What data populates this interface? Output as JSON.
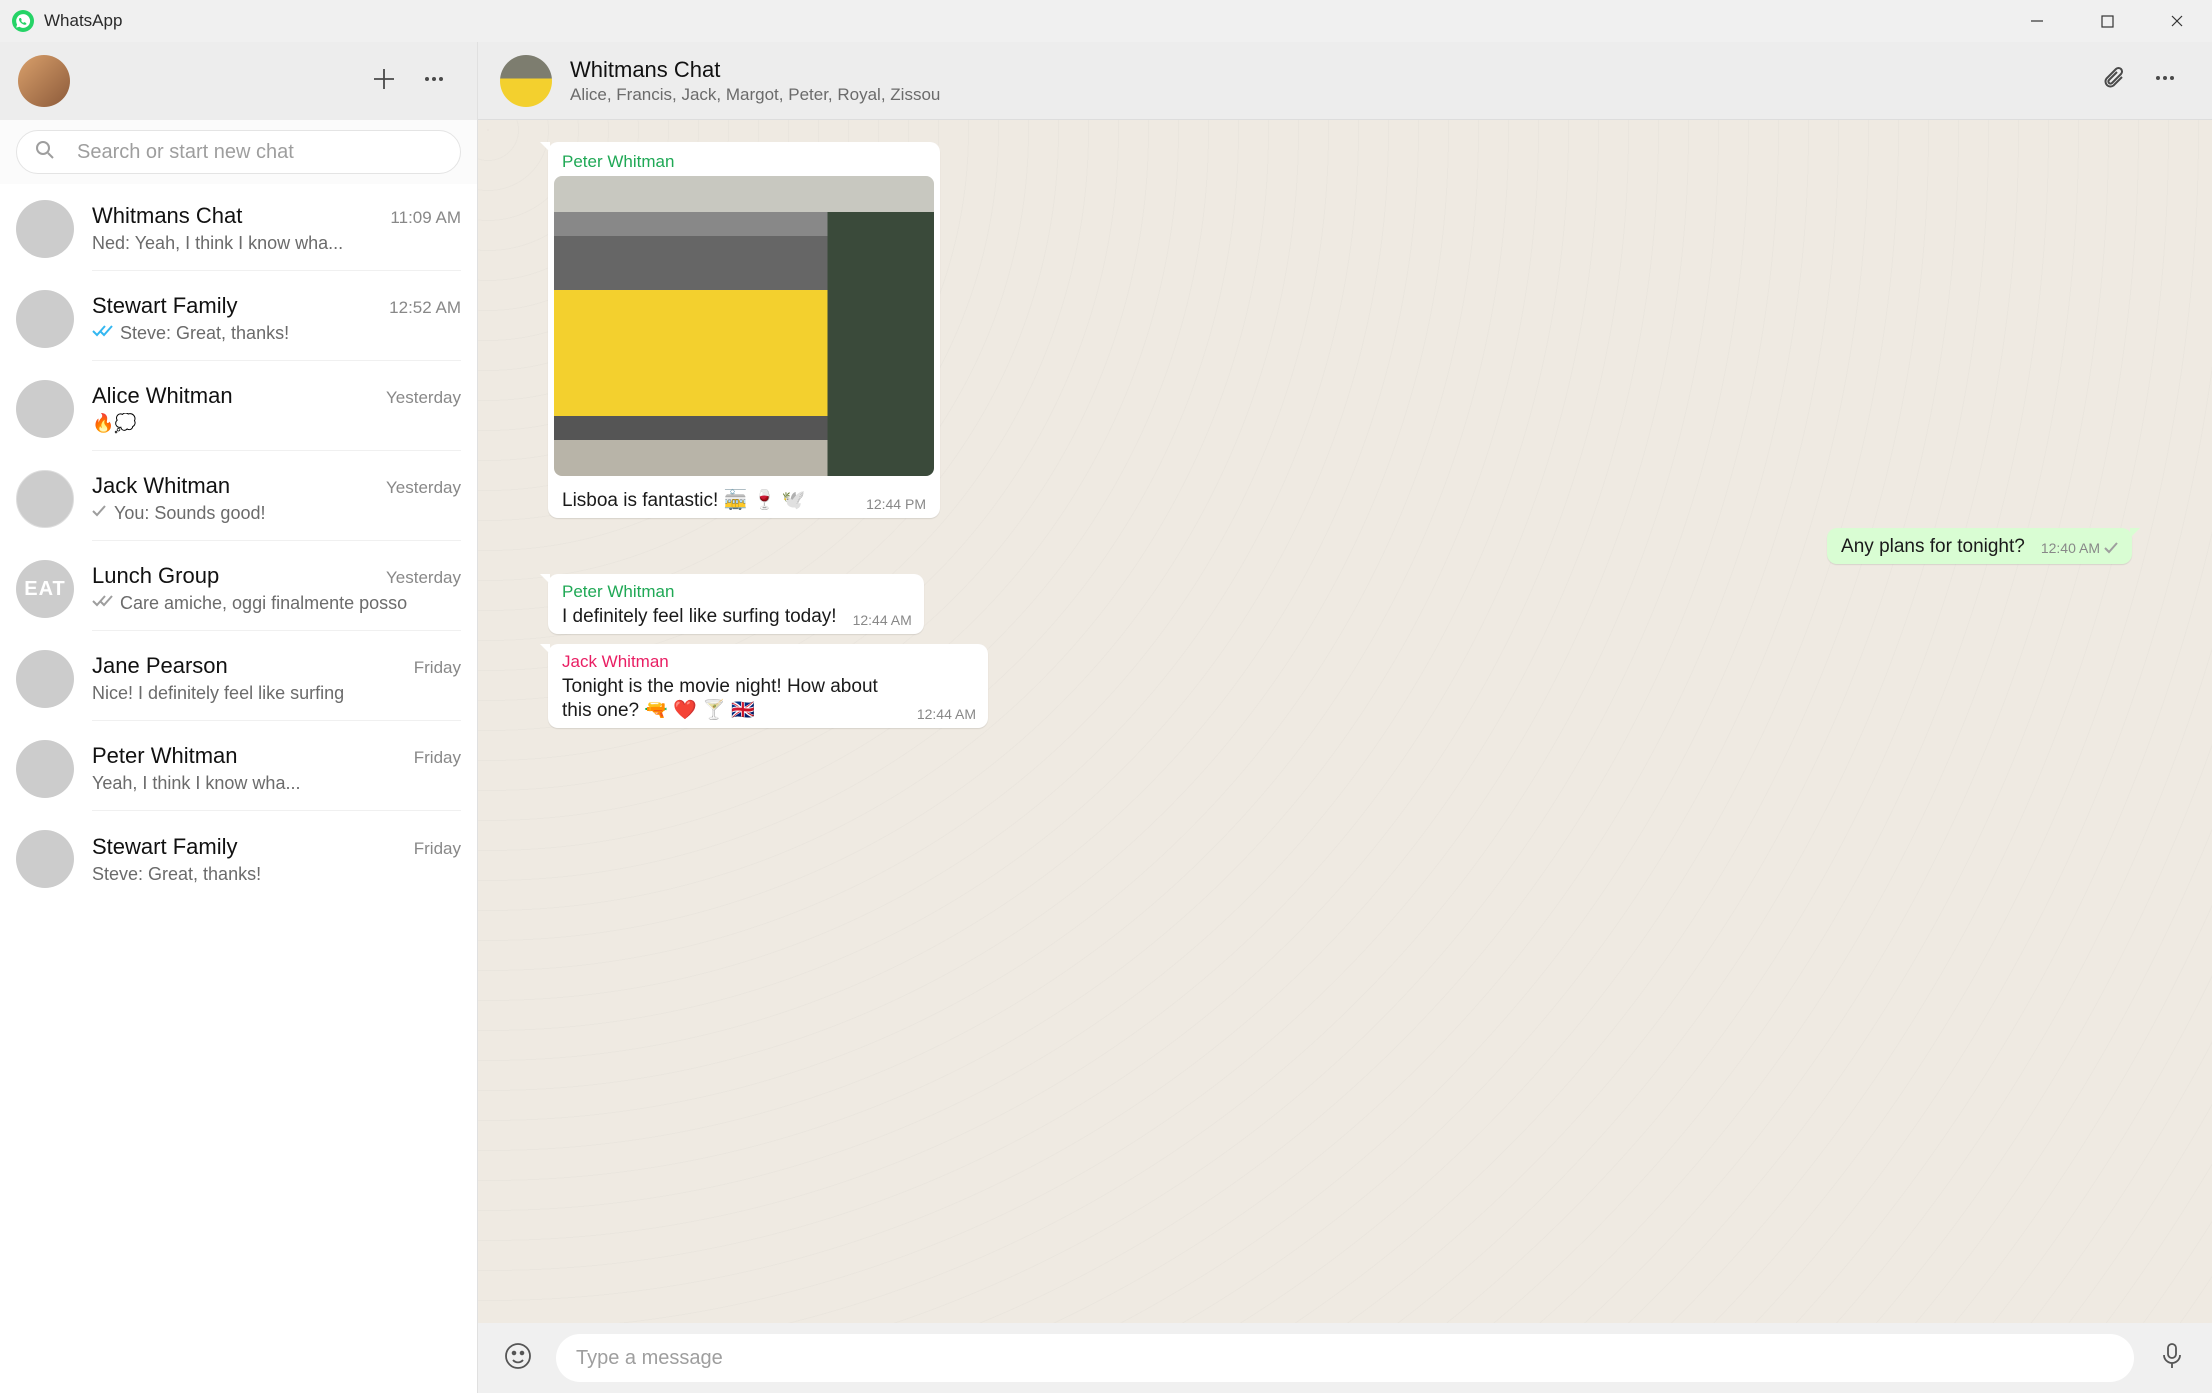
{
  "titlebar": {
    "app_name": "WhatsApp"
  },
  "sidebar": {
    "search_placeholder": "Search or start new chat",
    "chats": [
      {
        "name": "Whitmans Chat",
        "time": "11:09 AM",
        "preview": "Ned: Yeah, I think I know wha...",
        "tick": "none",
        "avatar": "av-tram"
      },
      {
        "name": "Stewart Family",
        "time": "12:52 AM",
        "preview": "Steve: Great, thanks!",
        "tick": "read",
        "avatar": "av-grass"
      },
      {
        "name": "Alice Whitman",
        "time": "Yesterday",
        "preview": "🔥💭",
        "tick": "none",
        "avatar": "av-alice"
      },
      {
        "name": "Jack Whitman",
        "time": "Yesterday",
        "preview": "You: Sounds good!",
        "tick": "sent",
        "avatar": "av-jack"
      },
      {
        "name": "Lunch Group",
        "time": "Yesterday",
        "preview": "Care amiche, oggi finalmente posso",
        "tick": "delivered",
        "avatar": "av-eat"
      },
      {
        "name": "Jane Pearson",
        "time": "Friday",
        "preview": "Nice! I definitely feel like surfing",
        "tick": "none",
        "avatar": "av-jane"
      },
      {
        "name": "Peter Whitman",
        "time": "Friday",
        "preview": "Yeah, I think I know wha...",
        "tick": "none",
        "avatar": "av-peter"
      },
      {
        "name": "Stewart Family",
        "time": "Friday",
        "preview": "Steve: Great, thanks!",
        "tick": "none",
        "avatar": "av-hands"
      }
    ]
  },
  "chat": {
    "title": "Whitmans Chat",
    "subtitle": "Alice, Francis, Jack, Margot, Peter, Royal, Zissou",
    "messages": [
      {
        "dir": "in",
        "sender": "Peter Whitman",
        "sender_color": "#1fa855",
        "media": true,
        "text": "Lisboa is fantastic!  🚋 🍷 🕊️",
        "time": "12:44 PM",
        "tail": true
      },
      {
        "dir": "out",
        "text": "Any plans for tonight?",
        "time": "12:40 AM",
        "status": "sent",
        "tail": true
      },
      {
        "dir": "in",
        "sender": "Peter Whitman",
        "sender_color": "#1fa855",
        "text": "I definitely feel like surfing today!",
        "time": "12:44 AM",
        "tail": true
      },
      {
        "dir": "in",
        "sender": "Jack Whitman",
        "sender_color": "#e91e63",
        "text": "Tonight is the movie night! How about this one?  🔫 ❤️ 🍸 🇬🇧",
        "time": "12:44 AM",
        "tail": true
      }
    ],
    "composer_placeholder": "Type a message"
  }
}
